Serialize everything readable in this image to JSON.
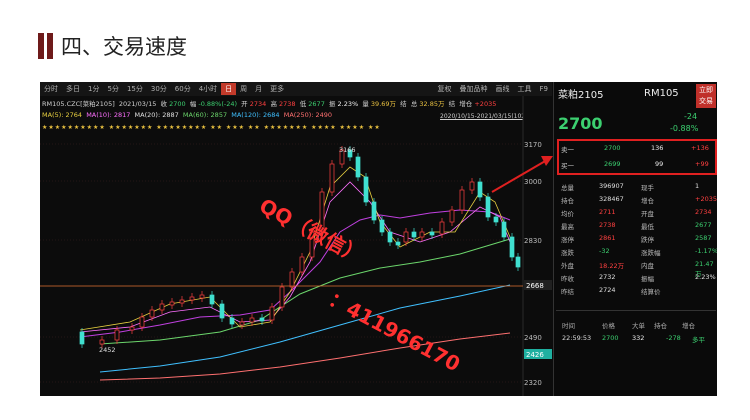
{
  "slide": {
    "title": "四、交易速度"
  },
  "toolbar": {
    "left": [
      "分时",
      "多日",
      "1分",
      "5分",
      "15分",
      "30分",
      "60分",
      "4小时",
      "日",
      "周",
      "月",
      "更多"
    ],
    "active_index": 8,
    "right": [
      "复权",
      "叠加品种",
      "画线",
      "工具",
      "F9"
    ]
  },
  "info": {
    "symbol": "RM105.CZC[菜粕2105]",
    "date": "2021/03/15",
    "close_label": "收",
    "close": "2700",
    "amp_label": "幅",
    "change": "-0.88%(-24)",
    "open_label": "开",
    "open": "2734",
    "high_label": "高",
    "high": "2738",
    "low_label": "低",
    "low": "2677",
    "zhen_label": "振",
    "zhen": "2.23%",
    "vol_label": "量",
    "vol": "39.69万",
    "jie_label": "结",
    "amt_label": "总",
    "amt": "32.85万",
    "jie2_label": "结",
    "pos_label": "增仓",
    "pos": "+2035",
    "range": "2020/10/15-2021/03/15(102日)",
    "ma5": "MA(5): 2764",
    "ma10": "MA(10): 2817",
    "ma20": "MA(20): 2887",
    "ma60": "MA(60): 2857",
    "ma120": "MA(120): 2684",
    "ma250": "MA(250): 2490",
    "stars": "★★★★★★★★★★    ★★★★★★★   ★★★★★★★★    ★★   ★★★   ★★   ★★★★★★★   ★★★★   ★★★★   ★★"
  },
  "chart_data": {
    "type": "line",
    "title": "",
    "y_ticks": [
      "3170",
      "3000",
      "2830",
      "2668",
      "2490",
      "2426",
      "2320"
    ],
    "ylim": [
      2320,
      3170
    ],
    "annotations": [
      "3166",
      "2452"
    ],
    "watermark": [
      "QQ（微信）",
      "：411966170"
    ]
  },
  "panel": {
    "name": "菜粕2105",
    "code": "RM105",
    "button": "立即\n交易",
    "price": "2700",
    "change": "-24",
    "change_pct": "-0.88%",
    "sell1": {
      "label": "卖一",
      "price": "2700",
      "vol": "136",
      "diff": "+136"
    },
    "buy1": {
      "label": "买一",
      "price": "2699",
      "vol": "99",
      "diff": "+99"
    },
    "stats": [
      [
        "总量",
        "396907",
        "现手",
        "1"
      ],
      [
        "持仓",
        "328467",
        "增仓",
        "+2035"
      ],
      [
        "均价",
        "2711",
        "开盘",
        "2734"
      ],
      [
        "最高",
        "2738",
        "最低",
        "2677"
      ],
      [
        "涨停",
        "2861",
        "跌停",
        "2587"
      ],
      [
        "涨跌",
        "-32",
        "涨跌幅",
        "-1.17%"
      ],
      [
        "外盘",
        "18.22万",
        "内盘",
        "21.47万"
      ],
      [
        "昨收",
        "2732",
        "振幅",
        "2.23%"
      ],
      [
        "昨结",
        "2724",
        "结算价",
        ""
      ]
    ],
    "ticks_header": [
      "时间",
      "价格",
      "大单",
      "持仓",
      "增仓"
    ],
    "tick": [
      "22:59:53",
      "2700",
      "332",
      "",
      "-278",
      "多平"
    ]
  },
  "colors": {
    "up": "#ff4040",
    "down": "#3cd070",
    "accent": "#c0302a",
    "bg": "#0c0c0c"
  }
}
